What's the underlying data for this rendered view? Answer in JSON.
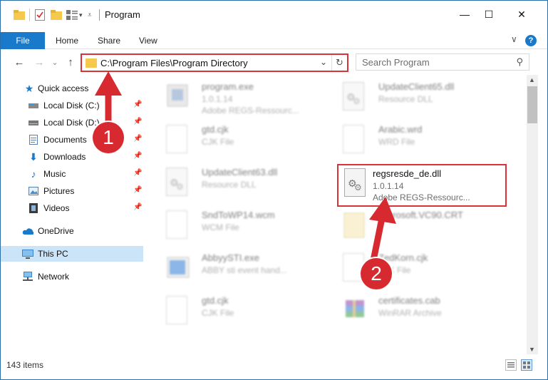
{
  "window": {
    "title": "Program",
    "minimize": "—",
    "maximize": "☐",
    "close": "✕"
  },
  "ribbon": {
    "tabs": [
      "File",
      "Home",
      "Share",
      "View"
    ],
    "expand": "∨",
    "help": "?"
  },
  "nav": {
    "back": "←",
    "forward": "→",
    "recent": "⌄",
    "up": "↑",
    "address_path": "C:\\Program Files\\Program Directory",
    "address_dropdown": "⌄",
    "refresh": "↻",
    "search_placeholder": "Search Program"
  },
  "sidebar": {
    "items": [
      {
        "label": "Quick access",
        "icon": "star-icon",
        "pinned": false
      },
      {
        "label": "Local Disk (C:)",
        "icon": "drive-icon",
        "pinned": true
      },
      {
        "label": "Local Disk (D:)",
        "icon": "drive-icon",
        "pinned": true
      },
      {
        "label": "Documents",
        "icon": "documents-icon",
        "pinned": true
      },
      {
        "label": "Downloads",
        "icon": "download-icon",
        "pinned": true
      },
      {
        "label": "Music",
        "icon": "music-icon",
        "pinned": true
      },
      {
        "label": "Pictures",
        "icon": "pictures-icon",
        "pinned": true
      },
      {
        "label": "Videos",
        "icon": "videos-icon",
        "pinned": true
      },
      {
        "label": "OneDrive",
        "icon": "cloud-icon",
        "pinned": false
      },
      {
        "label": "This PC",
        "icon": "computer-icon",
        "pinned": false,
        "selected": true
      },
      {
        "label": "Network",
        "icon": "network-icon",
        "pinned": false
      }
    ]
  },
  "files": [
    {
      "name": "program.exe",
      "line2": "1.0.1.14",
      "line3": "Adobe REGS-Ressourc...",
      "icon": "app"
    },
    {
      "name": "UpdateClient65.dll",
      "line2": "Resource DLL",
      "line3": "",
      "icon": "gear"
    },
    {
      "name": "gtd.cjk",
      "line2": "CJK File",
      "line3": "",
      "icon": "doc"
    },
    {
      "name": "Arabic.wrd",
      "line2": "WRD File",
      "line3": "",
      "icon": "doc"
    },
    {
      "name": "UpdateClient63.dll",
      "line2": "Resource DLL",
      "line3": "",
      "icon": "gear"
    },
    {
      "name": "regsresde_de.dll",
      "line2": "1.0.1.14",
      "line3": "Adobe REGS-Ressourc...",
      "icon": "gear"
    },
    {
      "name": "SndToWP14.wcm",
      "line2": "WCM File",
      "line3": "",
      "icon": "doc"
    },
    {
      "name": "Microsoft.VC90.CRT",
      "line2": "",
      "line3": "",
      "icon": "doc"
    },
    {
      "name": "AbbyySTI.exe",
      "line2": "ABBY sti event hand...",
      "line3": "",
      "icon": "app-blue"
    },
    {
      "name": "ZedKorn.cjk",
      "line2": "CJK File",
      "line3": "",
      "icon": "doc"
    },
    {
      "name": "gtd.cjk",
      "line2": "CJK File",
      "line3": "",
      "icon": "doc"
    },
    {
      "name": "certificates.cab",
      "line2": "WinRAR Archive",
      "line3": "",
      "icon": "archive"
    }
  ],
  "annotations": {
    "callout1": "1",
    "callout2": "2"
  },
  "status": {
    "item_count": "143 items"
  },
  "colors": {
    "accent": "#1979ca",
    "highlight_red": "#d9333a",
    "selected_bg": "#cce4f7",
    "folder": "#f5c94c"
  }
}
